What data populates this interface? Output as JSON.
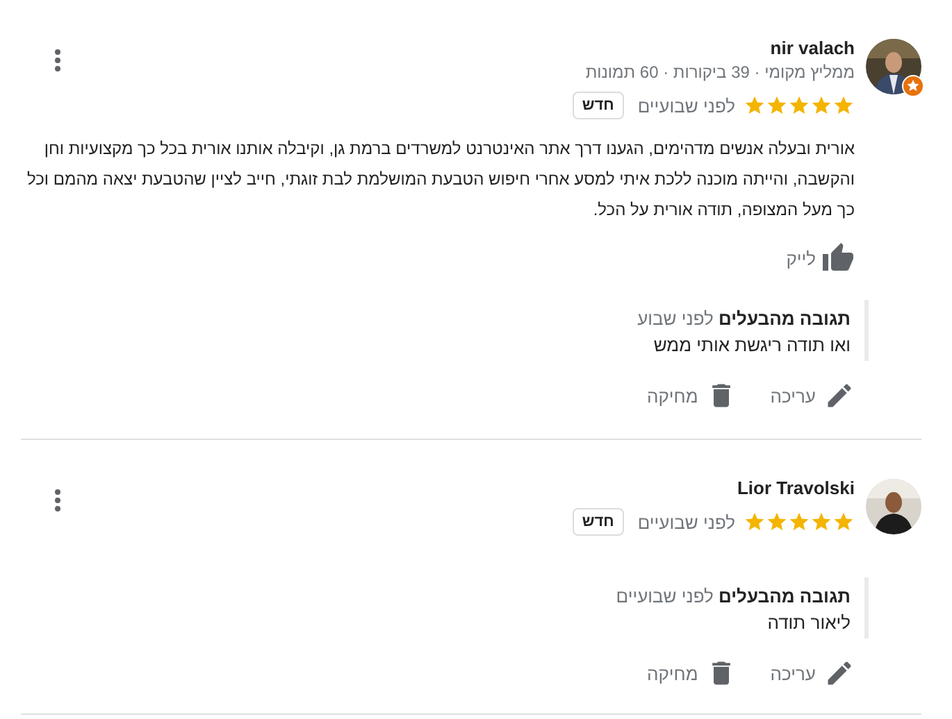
{
  "reviews": [
    {
      "reviewer": {
        "name": "nir valach",
        "subtitle": "ממליץ מקומי · 39 ביקורות · 60 תמונות",
        "local_guide_badge": true
      },
      "stars": 5,
      "time": "לפני שבועיים",
      "new_badge": "חדש",
      "text": "אורית ובעלה אנשים מדהימים, הגענו דרך אתר האינטרנט למשרדים ברמת גן, וקיבלה אותנו אורית בכל כך מקצועיות וחן והקשבה, והייתה מוכנה ללכת איתי למסע אחרי חיפוש הטבעת המושלמת לבת זוגתי, חייב לציין שהטבעת יצאה מהמם וכל כך מעל המצופה, תודה אורית על הכל.",
      "like": "לייק",
      "reply": {
        "label": "תגובה מהבעלים",
        "time": "לפני שבוע",
        "text": "ואו תודה ריגשת אותי ממש"
      },
      "actions": {
        "edit": "עריכה",
        "delete": "מחיקה"
      }
    },
    {
      "reviewer": {
        "name": "Lior Travolski",
        "local_guide_badge": false
      },
      "stars": 5,
      "time": "לפני שבועיים",
      "new_badge": "חדש",
      "reply": {
        "label": "תגובה מהבעלים",
        "time": "לפני שבועיים",
        "text": "ליאור תודה"
      },
      "actions": {
        "edit": "עריכה",
        "delete": "מחיקה"
      }
    }
  ]
}
